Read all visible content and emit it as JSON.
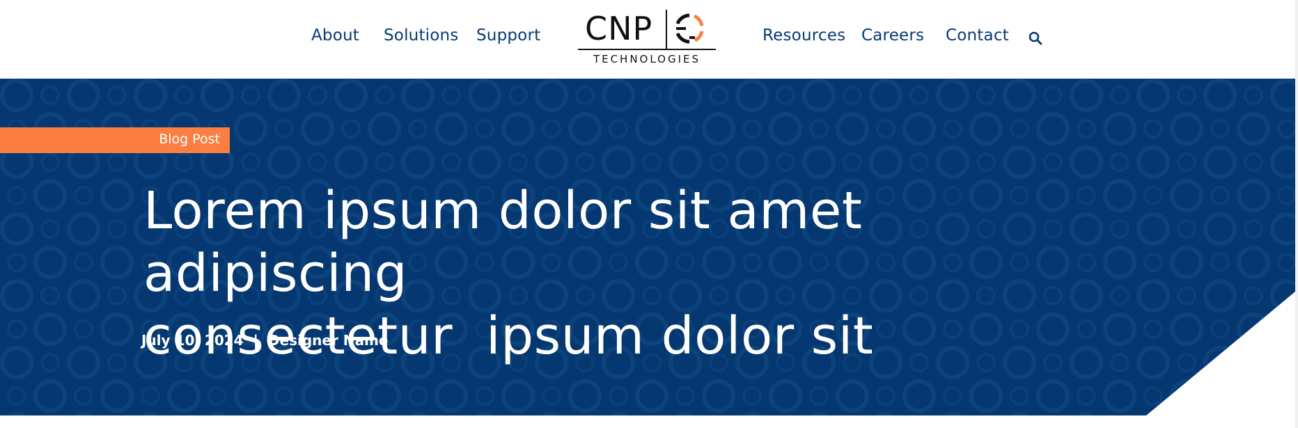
{
  "nav": {
    "left_items": [
      {
        "label": "About"
      },
      {
        "label": "Solutions"
      },
      {
        "label": "Support"
      }
    ],
    "right_items": [
      {
        "label": "Resources"
      },
      {
        "label": "Careers"
      },
      {
        "label": "Contact"
      }
    ],
    "search_icon": "search-icon"
  },
  "logo": {
    "wordmark": "CNP",
    "subtitle": "TECHNOLOGIES",
    "mark_icon": "cnp-circular-mark",
    "colors": {
      "text": "#111111",
      "mark_dark": "#111111",
      "mark_accent": "#fb7f42"
    }
  },
  "hero": {
    "badge": "Blog Post",
    "title": "Lorem ipsum dolor sit amet adipiscing\nconsectetur  ipsum dolor sit",
    "date": "July 10, 2024",
    "separator": "|",
    "author": "Designer Name"
  },
  "colors": {
    "brand_navy": "#053870",
    "nav_text": "#063a74",
    "accent_orange": "#fb7f42",
    "hero_text": "#ffffff"
  }
}
